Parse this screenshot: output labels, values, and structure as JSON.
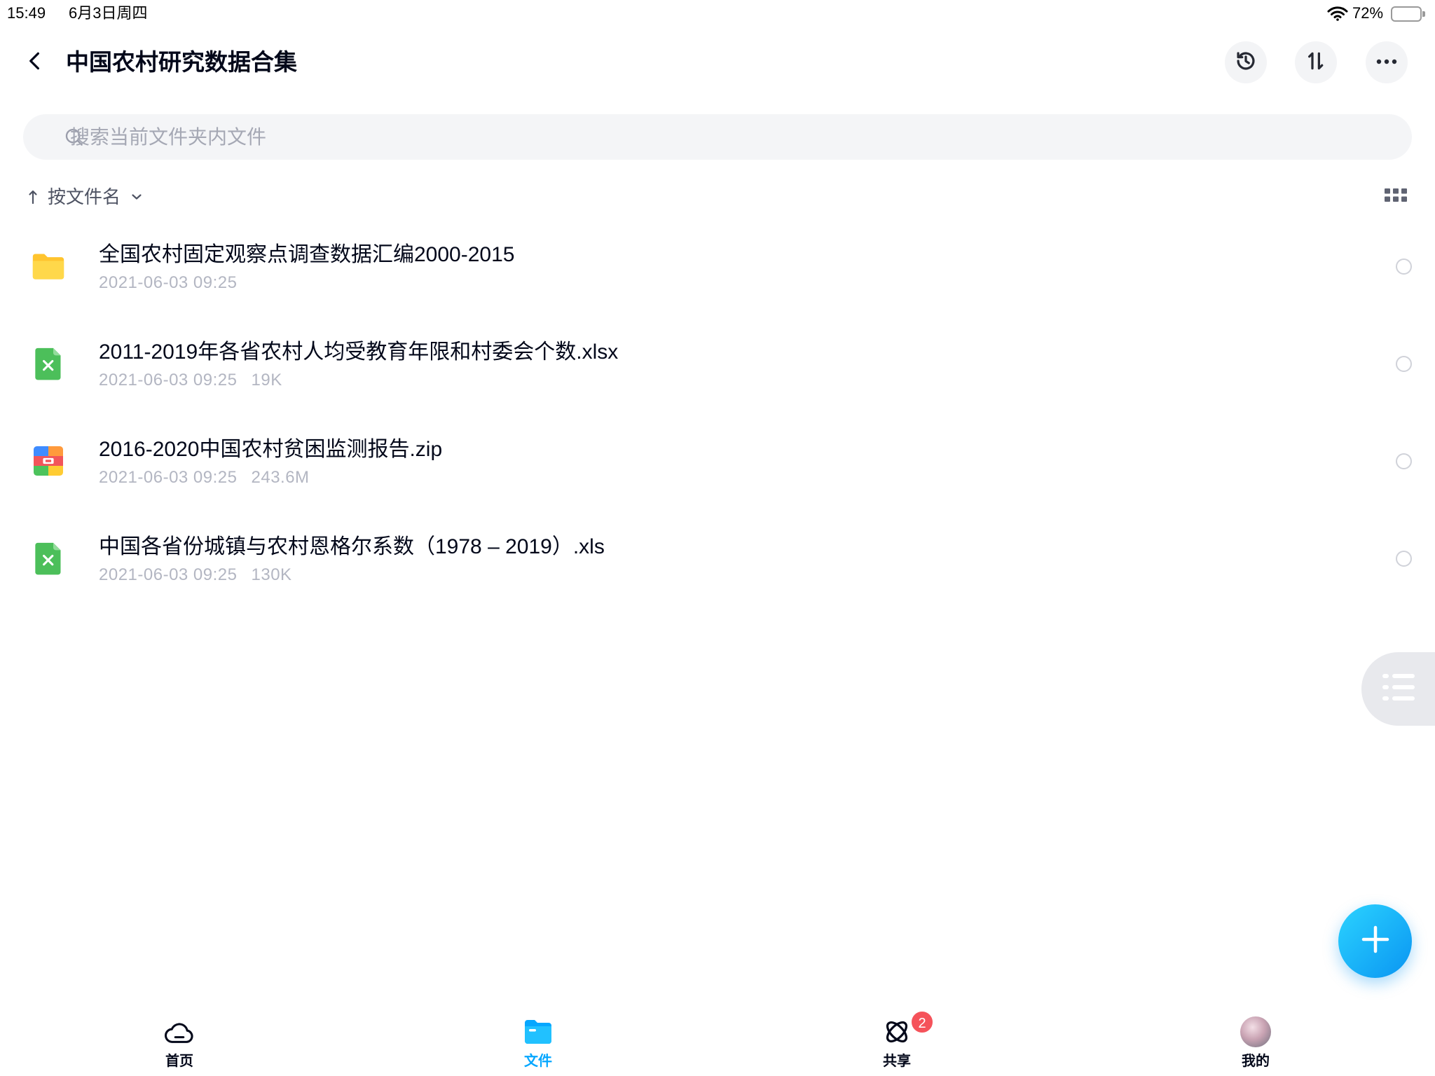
{
  "status_bar": {
    "time": "15:49",
    "date": "6月3日周四",
    "battery": "72%",
    "icons": [
      "wifi-icon",
      "battery-icon"
    ]
  },
  "header": {
    "title": "中国农村研究数据合集",
    "back_icon": "chevron-left-icon",
    "actions": [
      "history-icon",
      "sort-order-icon",
      "more-icon"
    ]
  },
  "search": {
    "placeholder": "搜索当前文件夹内文件",
    "icon": "search-icon"
  },
  "sort": {
    "label": "按文件名",
    "direction": "ascending",
    "view_icon": "grid-view-icon"
  },
  "files": [
    {
      "name": "全国农村固定观察点调查数据汇编2000-2015",
      "date": "2021-06-03 09:25",
      "type": "folder",
      "icon": "folder-icon"
    },
    {
      "name": "2011-2019年各省农村人均受教育年限和村委会个数.xlsx",
      "date": "2021-06-03 09:25",
      "size": "19K",
      "type": "excel",
      "icon": "excel-file-icon"
    },
    {
      "name": "2016-2020中国农村贫困监测报告.zip",
      "date": "2021-06-03 09:25",
      "size": "243.6M",
      "type": "zip",
      "icon": "zip-file-icon"
    },
    {
      "name": "中国各省份城镇与农村恩格尔系数（1978 – 2019）.xls",
      "date": "2021-06-03 09:25",
      "size": "130K",
      "type": "excel",
      "icon": "excel-file-icon"
    }
  ],
  "side_tab": {
    "icon": "list-icon"
  },
  "fab": {
    "icon": "plus-icon"
  },
  "tabs": [
    {
      "label": "首页",
      "icon": "cloud-icon",
      "active": false
    },
    {
      "label": "文件",
      "icon": "folder-icon",
      "active": true
    },
    {
      "label": "共享",
      "icon": "share-icon",
      "active": false,
      "badge": "2"
    },
    {
      "label": "我的",
      "icon": "avatar",
      "active": false
    }
  ],
  "colors": {
    "accent": "#06a7ff",
    "text": "#03081a",
    "secondary": "#b3b6c2",
    "badge": "#f5525a",
    "folder": "#ffd23f",
    "excel": "#4cbf5a"
  }
}
